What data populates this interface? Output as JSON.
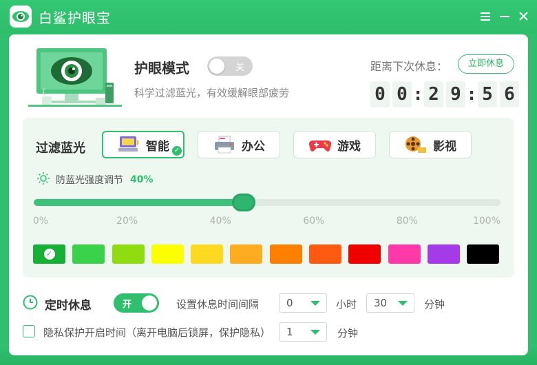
{
  "app": {
    "title": "白鲨护眼宝",
    "minimize_icon": "minimize-icon",
    "menu_icon": "menu-icon",
    "close_icon": "close-icon"
  },
  "header": {
    "mode_title": "护眼模式",
    "mode_toggle_label": "关",
    "mode_enabled": false,
    "mode_desc": "科学过滤蓝光，有效缓解眼部疲劳",
    "rest_label": "距离下次休息：",
    "rest_button": "立即休息",
    "timer": {
      "h1": "0",
      "h2": "0",
      "sep1": ":",
      "m1": "2",
      "m2": "9",
      "sep2": ":",
      "s1": "5",
      "s2": "6"
    }
  },
  "filter": {
    "label": "过滤蓝光",
    "modes": [
      {
        "label": "智能",
        "icon": "computer-icon",
        "active": true
      },
      {
        "label": "办公",
        "icon": "printer-icon",
        "active": false
      },
      {
        "label": "游戏",
        "icon": "gamepad-icon",
        "active": false
      },
      {
        "label": "影视",
        "icon": "film-reel-icon",
        "active": false
      }
    ],
    "strength_label": "防蓝光强度调节",
    "strength_value": "40%",
    "strength_fraction": 0.45,
    "ticks": [
      "0%",
      "20%",
      "40%",
      "60%",
      "80%",
      "100%"
    ],
    "swatches": [
      "#16b035",
      "#3ad24a",
      "#8fdd10",
      "#fcff00",
      "#ffd820",
      "#ffad20",
      "#ff8000",
      "#ff5a10",
      "#f10000",
      "#ff3aa8",
      "#a43ae8",
      "#000000"
    ],
    "selected_swatch": 0
  },
  "timed_rest": {
    "label": "定时休息",
    "toggle_label": "开",
    "enabled": true,
    "interval_label": "设置休息时间间隔",
    "hours_value": "0",
    "hours_unit": "小时",
    "minutes_value": "30",
    "minutes_unit": "分钟"
  },
  "privacy": {
    "label": "隐私保护开启时间（离开电脑后锁屏，保护隐私）",
    "checked": false,
    "minutes_value": "1",
    "minutes_unit": "分钟"
  }
}
